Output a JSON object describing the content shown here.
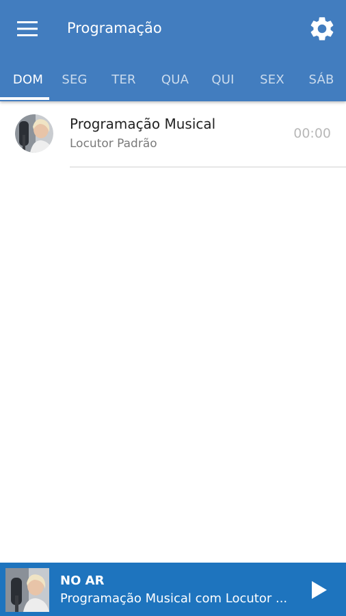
{
  "header": {
    "title": "Programação",
    "menu_icon": "hamburger-menu-icon",
    "settings_icon": "gear-icon",
    "bg_color": "#427dbf"
  },
  "tabs": [
    {
      "label": "DOM",
      "active": true
    },
    {
      "label": "SEG",
      "active": false
    },
    {
      "label": "TER",
      "active": false
    },
    {
      "label": "QUA",
      "active": false
    },
    {
      "label": "QUI",
      "active": false
    },
    {
      "label": "SEX",
      "active": false
    },
    {
      "label": "SÁB",
      "active": false
    }
  ],
  "schedule": [
    {
      "title": "Programação Musical",
      "host": "Locutor Padrão",
      "time": "00:00",
      "avatar_icon": "host-avatar"
    }
  ],
  "player": {
    "label": "NO AR",
    "now_playing": "Programação Musical com Locutor ...",
    "play_icon": "play-icon",
    "bg_color": "#1e74be"
  }
}
